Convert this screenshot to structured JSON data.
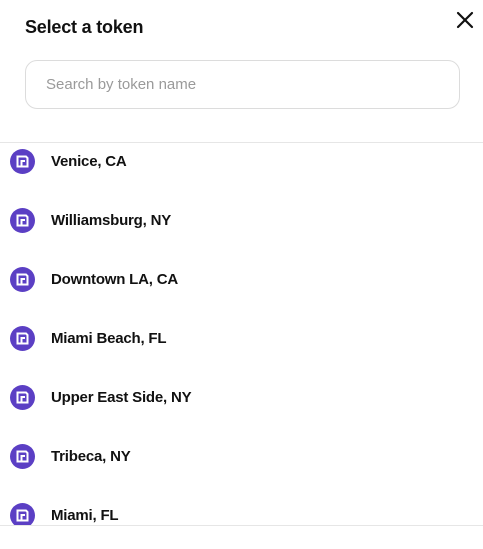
{
  "dialog": {
    "title": "Select a token",
    "close_icon": "close-icon"
  },
  "search": {
    "placeholder": "Search by token name",
    "value": ""
  },
  "tokens": [
    {
      "label": "Venice, CA",
      "icon": "token-logo-icon"
    },
    {
      "label": "Williamsburg, NY",
      "icon": "token-logo-icon"
    },
    {
      "label": "Downtown LA, CA",
      "icon": "token-logo-icon"
    },
    {
      "label": "Miami Beach, FL",
      "icon": "token-logo-icon"
    },
    {
      "label": "Upper East Side, NY",
      "icon": "token-logo-icon"
    },
    {
      "label": "Tribeca, NY",
      "icon": "token-logo-icon"
    },
    {
      "label": "Miami, FL",
      "icon": "token-logo-icon"
    }
  ],
  "colors": {
    "token_icon_bg": "#5b3fc4",
    "text": "#111111",
    "placeholder": "#9a9a9a",
    "border": "#dcdcdc"
  }
}
